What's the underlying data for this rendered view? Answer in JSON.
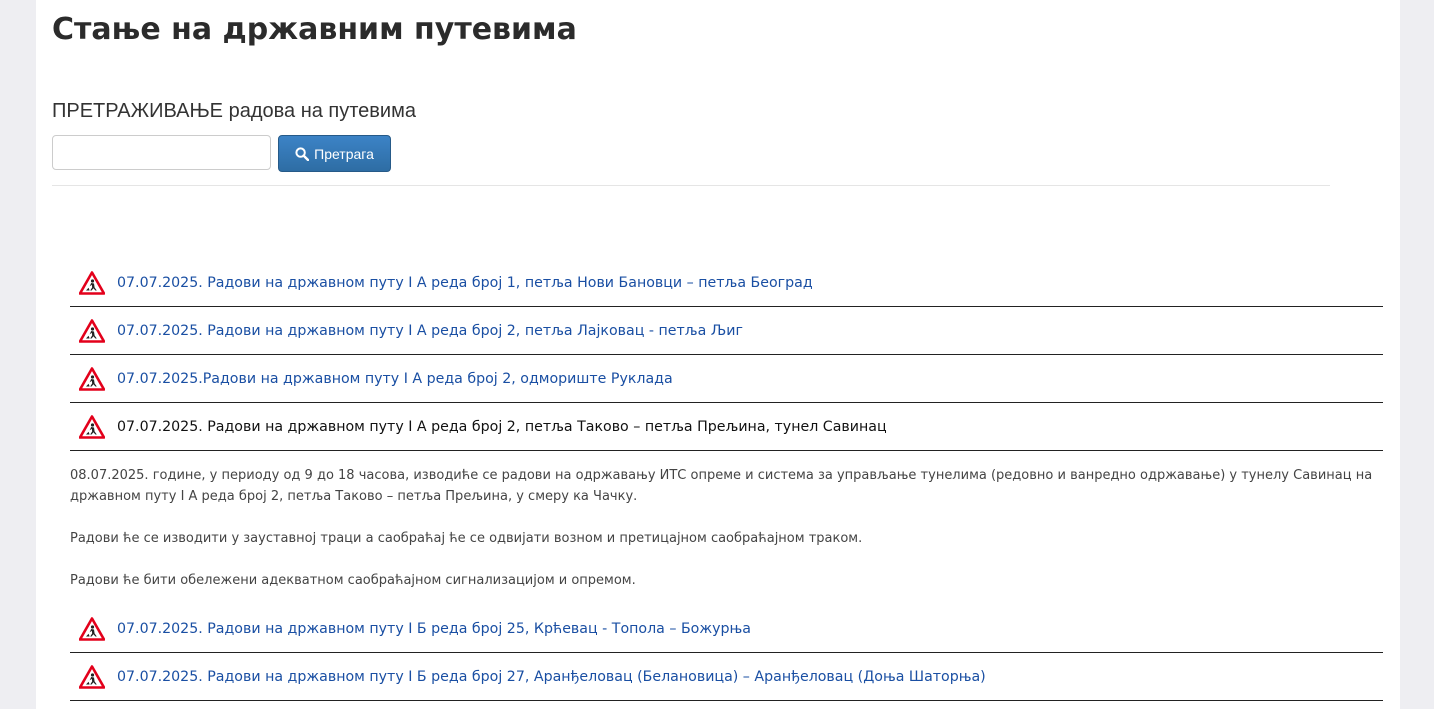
{
  "page": {
    "title": "Стање на државним путевима"
  },
  "search": {
    "heading": "ПРЕТРАЖИВАЊЕ радова на путевима",
    "input_value": "",
    "placeholder": "",
    "button_label": "Претрага",
    "button_icon": "search-icon"
  },
  "colors": {
    "link": "#1a4fa3",
    "button": "#337ab7",
    "warning_red": "#e3001b"
  },
  "items": [
    {
      "label": "07.07.2025. Радови на државном путу I А реда број 1, петља Нови Бановци – петља Београд",
      "icon": "roadworks-warning-icon"
    },
    {
      "label": "07.07.2025. Радови на државном путу I А реда број 2, петља Лајковац - петља Љиг",
      "icon": "roadworks-warning-icon"
    },
    {
      "label": "07.07.2025.Радови на државном путу I А реда број 2, одмориште Руклада",
      "icon": "roadworks-warning-icon"
    },
    {
      "label": "07.07.2025. Радови на државном путу I А реда број 2, петља Таково – петља Прељина, тунел Савинац",
      "icon": "roadworks-warning-icon"
    },
    {
      "label": "07.07.2025. Радови на државном путу I Б реда број 25, Крћевац - Топола – Божурња",
      "icon": "roadworks-warning-icon"
    },
    {
      "label": "07.07.2025. Радови на државном путу I Б реда број 27, Аранђеловац (Белановица) – Аранђеловац (Доња Шаторња)",
      "icon": "roadworks-warning-icon"
    }
  ],
  "expanded_detail": {
    "paragraph_1": "08.07.2025. године, у периоду од 9 до 18 часова, изводиће се радови на одржавању ИТС опреме и система за управљање тунелима (редовно и ванредно одржавање) у тунелу Савинац на државном путу I А реда број 2, петља Таково – петља Прељина, у смеру ка Чачку.",
    "paragraph_2": "Радови ће се изводити у зауставној траци а саобраћај ће се одвијати возном и претицајном саобраћајном траком.",
    "paragraph_3": "Радови ће бити обележени адекватном саобраћајном сигнализацијом и опремом."
  }
}
